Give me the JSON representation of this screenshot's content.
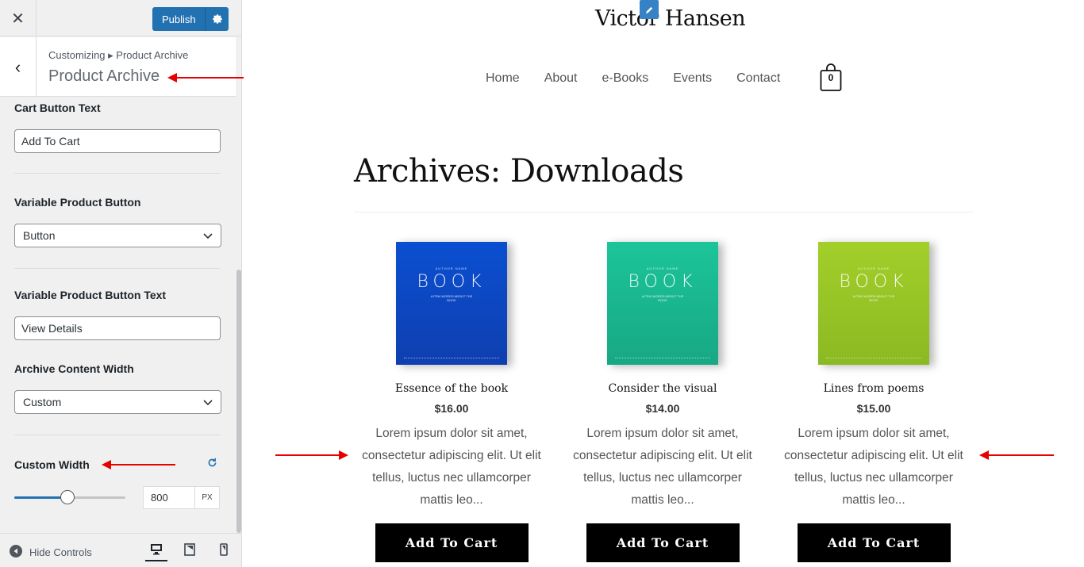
{
  "sidebar": {
    "close_icon": "close-icon",
    "publish_label": "Publish",
    "breadcrumb": "Customizing ▸ Product Archive",
    "section_title": "Product Archive",
    "controls": {
      "cart_button_text": {
        "label": "Cart Button Text",
        "value": "Add To Cart"
      },
      "variable_button": {
        "label": "Variable Product Button",
        "value": "Button"
      },
      "variable_button_text": {
        "label": "Variable Product Button Text",
        "value": "View Details"
      },
      "archive_width": {
        "label": "Archive Content Width",
        "value": "Custom"
      },
      "custom_width": {
        "label": "Custom Width",
        "value": "800",
        "unit": "PX",
        "slider_fraction": 0.48
      }
    },
    "footer": {
      "hide_controls": "Hide Controls"
    }
  },
  "preview": {
    "site_title": "Victor Hansen",
    "nav": [
      "Home",
      "About",
      "e-Books",
      "Events",
      "Contact"
    ],
    "cart_count": "0",
    "archive_title": "Archives: Downloads",
    "products": [
      {
        "name": "Essence of the book",
        "price": "$16.00",
        "desc": "Lorem ipsum dolor sit amet, consectetur adipiscing elit. Ut elit tellus, luctus nec ullamcorper mattis leo...",
        "button": "Add To Cart",
        "cover_color": "#0a4fd1",
        "cover_color2": "#0f3fb0",
        "cover_author": "AUTHOR NAME",
        "cover_word": "BOOK",
        "cover_sub": "A FEW WORDS ABOUT THE BOOK"
      },
      {
        "name": "Consider the visual",
        "price": "$14.00",
        "desc": "Lorem ipsum dolor sit amet, consectetur adipiscing elit. Ut elit tellus, luctus nec ullamcorper mattis leo...",
        "button": "Add To Cart",
        "cover_color": "#1cc49a",
        "cover_color2": "#17a884",
        "cover_author": "AUTHOR NAME",
        "cover_word": "BOOK",
        "cover_sub": "A FEW WORDS ABOUT THE BOOK"
      },
      {
        "name": "Lines from poems",
        "price": "$15.00",
        "desc": "Lorem ipsum dolor sit amet, consectetur adipiscing elit. Ut elit tellus, luctus nec ullamcorper mattis leo...",
        "button": "Add To Cart",
        "cover_color": "#a3cf2a",
        "cover_color2": "#8bb922",
        "cover_author": "AUTHOR NAME",
        "cover_word": "BOOK",
        "cover_sub": "A FEW WORDS ABOUT THE BOOK"
      }
    ]
  },
  "colors": {
    "accent": "#2271b1",
    "annotation_arrow": "#e60000"
  }
}
